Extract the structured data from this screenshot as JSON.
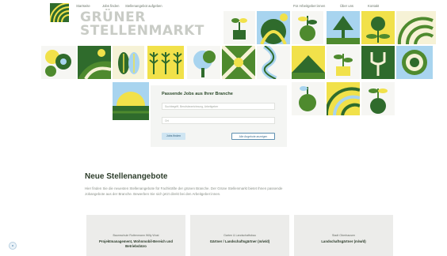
{
  "nav": {
    "links": [
      "Startseite",
      "Jobs finden",
      "Stellenangebot aufgeben"
    ],
    "right_links": [
      "Für Arbeitgeber:innen",
      "Über uns",
      "Kontakt"
    ]
  },
  "brand": {
    "line1": "GRÜNER",
    "line2": "STELLENMARKT"
  },
  "search": {
    "title": "Passende Jobs aus Ihrer Branche",
    "keyword_placeholder": "Suchbegriff, Berufsbezeichnung, Arbeitgeber",
    "location_placeholder": "Ort",
    "search_label": "Jobs finden",
    "all_label": "Alle Angebote anzeigen"
  },
  "listings": {
    "title": "Neue Stellenangebote",
    "intro": "Hier finden Sie die neuesten Stellenangebote für Fachkräfte der grünen Branche. Der Grüne Stellenmarkt bietet Ihnen passende Jobangebote aus der Branche. Bewerben Sie sich jetzt direkt bei den Arbeitgeber:innen.",
    "cards": [
      {
        "company": "Baumschule Rottenmann Willy Wust",
        "title": "Projektmanagement, Wohnmobil-Bereich und Betriebsbüro"
      },
      {
        "company": "Garten & Landschaftsbau",
        "title": "Gärtner / Landschaftsgärtner (m/w/d)"
      },
      {
        "company": "Stadt Oberhausen",
        "title": "Landschaftsgärtner (m/w/d)"
      }
    ]
  },
  "colors": {
    "dark_green": "#2f6b2c",
    "mid_green": "#4e8a2e",
    "yellow": "#f1e14a",
    "light_blue": "#a8d4ef",
    "cream": "#f6f2d6"
  }
}
